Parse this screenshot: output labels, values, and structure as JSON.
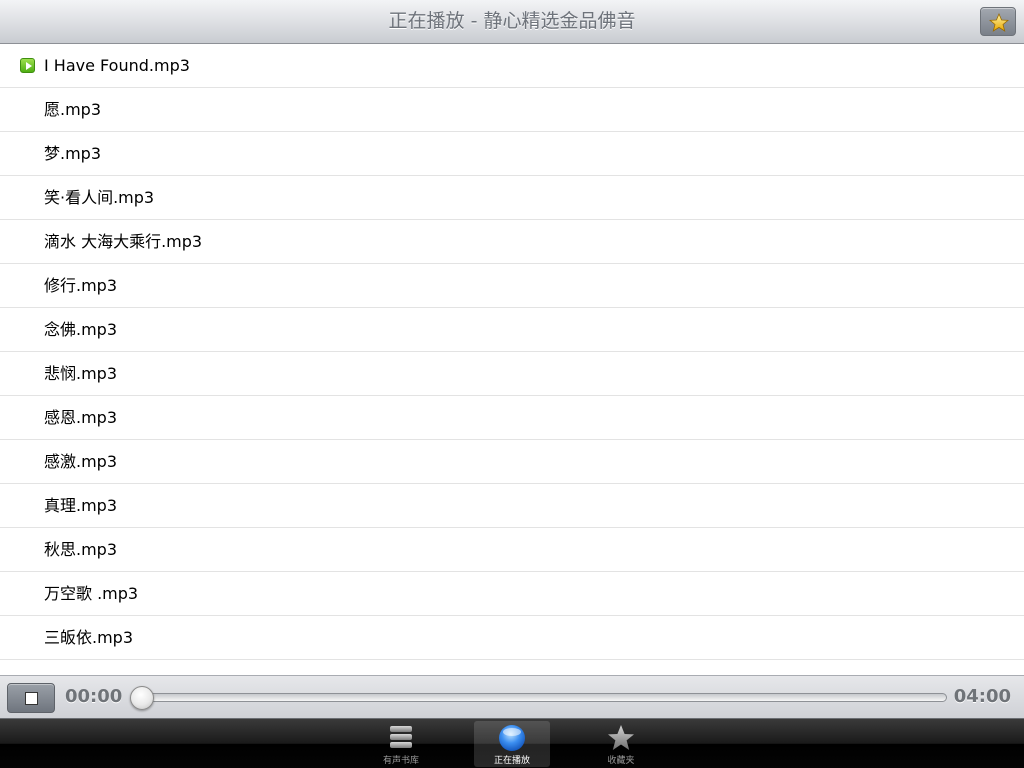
{
  "header": {
    "title": "正在播放 - 静心精选金品佛音",
    "favorite_icon": "star-icon"
  },
  "tracks": [
    {
      "name": "I Have Found.mp3",
      "playing": true
    },
    {
      "name": "愿.mp3"
    },
    {
      "name": "梦.mp3"
    },
    {
      "name": "笑·看人间.mp3"
    },
    {
      "name": "滴水 大海大乘行.mp3"
    },
    {
      "name": "修行.mp3"
    },
    {
      "name": "念佛.mp3"
    },
    {
      "name": "悲悯.mp3"
    },
    {
      "name": "感恩.mp3"
    },
    {
      "name": "感激.mp3"
    },
    {
      "name": "真理.mp3"
    },
    {
      "name": "秋思.mp3"
    },
    {
      "name": "万空歌 .mp3"
    },
    {
      "name": "三皈依.mp3"
    }
  ],
  "player": {
    "current_time": "00:00",
    "total_time": "04:00",
    "progress": 0,
    "stop_icon": "stop-icon"
  },
  "tabs": [
    {
      "label": "有声书库",
      "icon": "books-stack-icon",
      "active": false
    },
    {
      "label": "正在播放",
      "icon": "blue-orb-icon",
      "active": true
    },
    {
      "label": "收藏夹",
      "icon": "star-icon",
      "active": false
    }
  ],
  "colors": {
    "title_text": "#6e737b",
    "playing_indicator": "#5cbc1d",
    "tab_active_text": "#ffffff"
  }
}
